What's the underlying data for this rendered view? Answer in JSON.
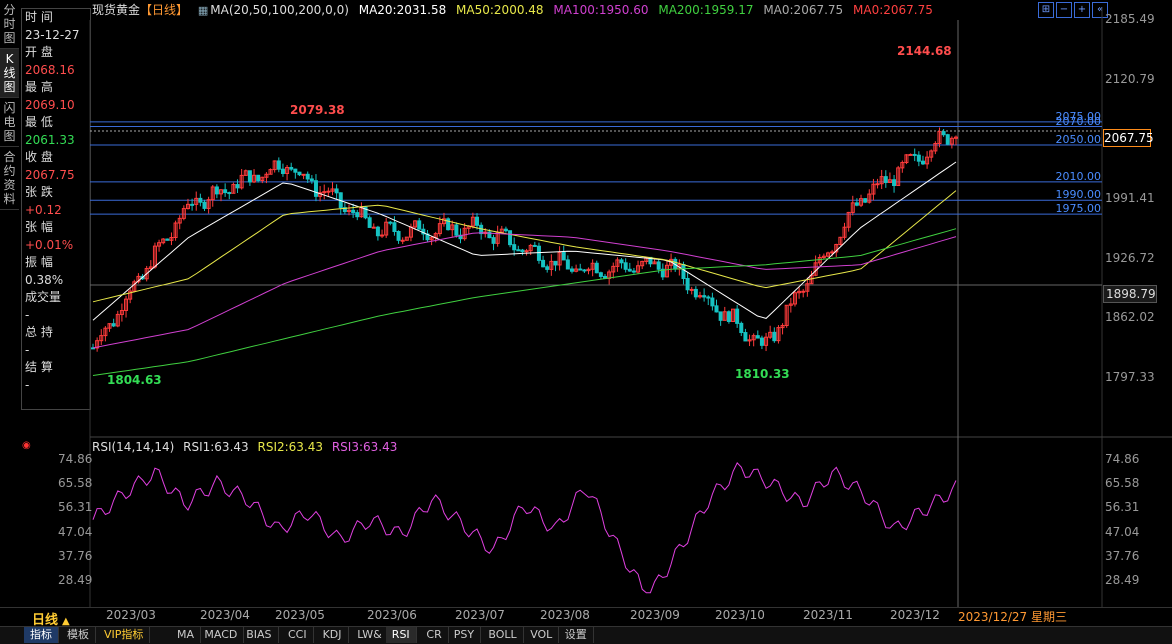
{
  "vtabs": [
    "分时图",
    "K线图",
    "闪电图",
    "合约资料"
  ],
  "info": {
    "rows": [
      {
        "label": "时 间",
        "value": "23-12-27",
        "color": "#dddddd"
      },
      {
        "label": "开 盘",
        "value": "2068.16",
        "color": "#ff4d4d"
      },
      {
        "label": "最 高",
        "value": "2069.10",
        "color": "#ff4d4d"
      },
      {
        "label": "最 低",
        "value": "2061.33",
        "color": "#33dd55"
      },
      {
        "label": "收 盘",
        "value": "2067.75",
        "color": "#ff4d4d"
      },
      {
        "label": "张 跌",
        "value": "+0.12",
        "color": "#ff4d4d"
      },
      {
        "label": "张 幅",
        "value": "+0.01%",
        "color": "#ff4d4d"
      },
      {
        "label": "振 幅",
        "value": "0.38%",
        "color": "#dddddd"
      },
      {
        "label": "成交量",
        "value": "-",
        "color": "#dddddd"
      },
      {
        "label": "总 持",
        "value": "-",
        "color": "#dddddd"
      },
      {
        "label": "结 算",
        "value": "-",
        "color": "#dddddd"
      }
    ]
  },
  "header": {
    "instrument": "现货黄金",
    "period": "【日线】",
    "ma_params": "MA(20,50,100,200,0,0)",
    "ma20": "MA20:2031.58",
    "ma50": "MA50:2000.48",
    "ma100": "MA100:1950.60",
    "ma200": "MA200:1959.17",
    "ma0a": "MA0:2067.75",
    "ma0b": "MA0:2067.75",
    "colors": {
      "ma20": "#ffffff",
      "ma50": "#e8e84a",
      "ma100": "#d040d0",
      "ma200": "#40d040",
      "ma0a": "#aaaaaa",
      "ma0b": "#ff4040"
    }
  },
  "toolbar_icons": [
    "grid-icon",
    "minus-icon",
    "plus-icon",
    "collapse-icon"
  ],
  "price_axis": [
    "2185.49",
    "2120.79",
    "1991.41",
    "1926.72",
    "1862.02",
    "1797.33"
  ],
  "price_axis_values": [
    2185.49,
    2120.79,
    1991.41,
    1926.72,
    1862.02,
    1797.33
  ],
  "current_price": "2067.75",
  "crosshair_price": "1898.79",
  "hlines": [
    {
      "label": "2075.00",
      "value": 2075.0
    },
    {
      "label": "2070.00",
      "value": 2070.0
    },
    {
      "label": "2050.00",
      "value": 2050.0
    },
    {
      "label": "2010.00",
      "value": 2010.0
    },
    {
      "label": "1990.00",
      "value": 1990.0
    },
    {
      "label": "1975.00",
      "value": 1975.0
    }
  ],
  "annotations": [
    {
      "label": "2144.68",
      "color": "#ff4d4d"
    },
    {
      "label": "2079.38",
      "color": "#ff4d4d"
    },
    {
      "label": "1804.63",
      "color": "#33dd55"
    },
    {
      "label": "1810.33",
      "color": "#33dd55"
    }
  ],
  "rsi": {
    "params": "RSI(14,14,14)",
    "rsi1": "RSI1:63.43",
    "rsi2": "RSI2:63.43",
    "rsi3": "RSI3:63.43",
    "axis": [
      "74.86",
      "65.58",
      "56.31",
      "47.04",
      "37.76",
      "28.49"
    ],
    "axis_values": [
      74.86,
      65.58,
      56.31,
      47.04,
      37.76,
      28.49
    ]
  },
  "dates": [
    "2023/03",
    "2023/04",
    "2023/05",
    "2023/06",
    "2023/07",
    "2023/08",
    "2023/09",
    "2023/10",
    "2023/11",
    "2023/12"
  ],
  "cursor_date": "2023/12/27 星期三",
  "period_tab": "日线",
  "bottom_tabs": [
    "指标",
    "模板",
    "VIP指标",
    "MA",
    "MACD",
    "BIAS",
    "CCI",
    "KDJ",
    "LW&",
    "RSI",
    "CR",
    "PSY",
    "BOLL",
    "VOL",
    "设置"
  ],
  "chart_data": {
    "type": "line",
    "x": [
      "2023/03",
      "2023/04",
      "2023/05",
      "2023/06",
      "2023/07",
      "2023/08",
      "2023/09",
      "2023/10",
      "2023/11",
      "2023/12/27"
    ],
    "series": [
      {
        "name": "现货黄金",
        "values": [
          1830,
          1985,
          2030,
          1955,
          1960,
          1915,
          1920,
          1830,
          1990,
          2067.75
        ]
      },
      {
        "name": "MA20",
        "values": [
          1860,
          1950,
          2010,
          1975,
          1930,
          1935,
          1925,
          1860,
          1960,
          2031.58
        ]
      },
      {
        "name": "MA50",
        "values": [
          1880,
          1905,
          1975,
          1985,
          1960,
          1940,
          1925,
          1895,
          1915,
          2000.48
        ]
      },
      {
        "name": "MA100",
        "values": [
          1830,
          1850,
          1900,
          1935,
          1955,
          1950,
          1935,
          1915,
          1920,
          1950.6
        ]
      },
      {
        "name": "MA200",
        "values": [
          1800,
          1815,
          1840,
          1865,
          1885,
          1900,
          1915,
          1920,
          1930,
          1959.17
        ]
      }
    ],
    "ylim": [
      1790,
      2190
    ]
  }
}
